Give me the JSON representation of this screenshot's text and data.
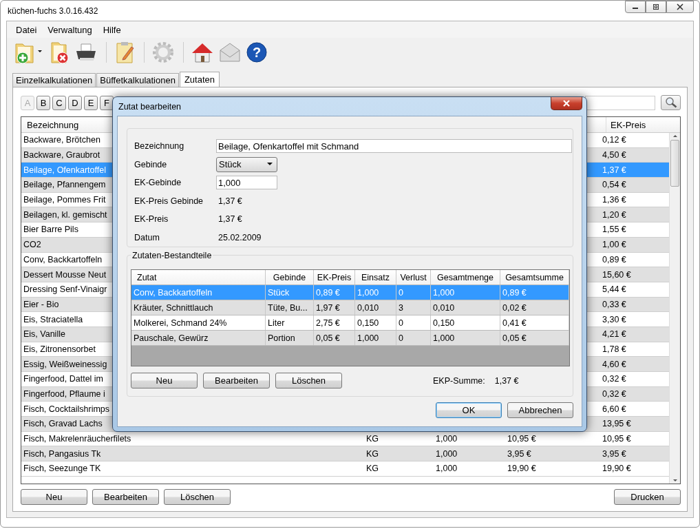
{
  "window": {
    "title": "küchen-fuchs 3.0.16.432"
  },
  "menu": [
    "Datei",
    "Verwaltung",
    "Hilfe"
  ],
  "help_glyph": "?",
  "tabs": [
    {
      "label": "Einzelkalkulationen",
      "selected": false
    },
    {
      "label": "Büffetkalkulationen",
      "selected": false
    },
    {
      "label": "Zutaten",
      "selected": true
    }
  ],
  "letters": [
    {
      "label": "A",
      "disabled": true
    },
    {
      "label": "B",
      "disabled": false
    },
    {
      "label": "C",
      "disabled": false
    },
    {
      "label": "D",
      "disabled": false
    },
    {
      "label": "E",
      "disabled": false
    },
    {
      "label": "F",
      "disabled": false
    }
  ],
  "table": {
    "columns": [
      "Bezeichnung",
      "EK-Preis"
    ],
    "rows": [
      {
        "name": "Backware, Brötchen",
        "ek_preis": "0,12 €",
        "selected": false
      },
      {
        "name": "Backware, Graubrot",
        "ek_preis": "4,50 €",
        "selected": false
      },
      {
        "name": "Beilage, Ofenkartoffel",
        "ek_preis": "1,37 €",
        "selected": true
      },
      {
        "name": "Beilage, Pfannengem",
        "ek_preis": "0,54 €",
        "selected": false
      },
      {
        "name": "Beilage, Pommes Frit",
        "ek_preis": "1,36 €",
        "selected": false
      },
      {
        "name": "Beilagen, kl. gemischt",
        "ek_preis": "1,20 €",
        "selected": false
      },
      {
        "name": "Bier Barre Pils",
        "ek_preis": "1,55 €",
        "selected": false
      },
      {
        "name": "CO2",
        "ek_preis": "1,00 €",
        "selected": false
      },
      {
        "name": "Conv, Backkartoffeln",
        "ek_preis": "0,89 €",
        "selected": false
      },
      {
        "name": "Dessert Mousse Neut",
        "ek_preis": "15,60 €",
        "selected": false
      },
      {
        "name": "Dressing Senf-Vinaigr",
        "ek_preis": "5,44 €",
        "selected": false
      },
      {
        "name": "Eier - Bio",
        "ek_preis": "0,33 €",
        "selected": false
      },
      {
        "name": "Eis, Straciatella",
        "ek_preis": "3,30 €",
        "selected": false
      },
      {
        "name": "Eis, Vanille",
        "ek_preis": "4,21 €",
        "selected": false
      },
      {
        "name": "Eis, Zitronensorbet",
        "ek_preis": "1,78 €",
        "selected": false
      },
      {
        "name": "Essig, Weißweinessig",
        "ek_preis": "4,60 €",
        "selected": false
      },
      {
        "name": "Fingerfood, Dattel im",
        "ek_preis": "0,32 €",
        "selected": false
      },
      {
        "name": "Fingerfood, Pflaume i",
        "ek_preis": "0,32 €",
        "selected": false
      },
      {
        "name": "Fisch, Cocktailshrimps",
        "ek_preis": "6,60 €",
        "selected": false
      },
      {
        "name": "Fisch, Gravad Lachs",
        "ek_preis": "13,95 €",
        "selected": false
      },
      {
        "name": "Fisch, Makrelenräucherfilets",
        "column_2": "KG",
        "column_3": "1,000",
        "column_4": "10,95 €",
        "ek_preis": "10,95 €",
        "selected": false
      },
      {
        "name": "Fisch, Pangasius Tk",
        "column_2": "KG",
        "column_3": "1,000",
        "column_4": "3,95 €",
        "ek_preis": "3,95 €",
        "selected": false
      },
      {
        "name": "Fisch, Seezunge TK",
        "column_2": "KG",
        "column_3": "1,000",
        "column_4": "19,90 €",
        "ek_preis": "19,90 €",
        "selected": false
      }
    ]
  },
  "buttons": [
    "Neu",
    "Bearbeiten",
    "Löschen"
  ],
  "print_button": "Drucken",
  "dialog": {
    "title": "Zutat bearbeiten",
    "fields": [
      {
        "label": "Bezeichnung",
        "kind": "text",
        "value": "Beilage, Ofenkartoffel mit Schmand"
      },
      {
        "label": "Gebinde",
        "kind": "select",
        "value": "Stück"
      },
      {
        "label": "EK-Gebinde",
        "kind": "input",
        "value": "1,000"
      },
      {
        "label": "EK-Preis Gebinde",
        "kind": "readonly",
        "value": "1,37 €"
      },
      {
        "label": "EK-Preis",
        "kind": "readonly",
        "value": "1,37 €"
      },
      {
        "label": "Datum",
        "kind": "readonly",
        "value": "25.02.2009"
      }
    ],
    "group_title": "Zutaten-Bestandteile",
    "components": {
      "columns": [
        "Zutat",
        "Gebinde",
        "EK-Preis",
        "Einsatz",
        "Verlust",
        "Gesamtmenge",
        "Gesamtsumme"
      ],
      "rows": [
        {
          "cells": [
            "Conv, Backkartoffeln",
            "Stück",
            "0,89 €",
            "1,000",
            "0",
            "1,000",
            "0,89 €"
          ],
          "selected": true
        },
        {
          "cells": [
            "Kräuter, Schnittlauch",
            "Tüte, Bu...",
            "1,97 €",
            "0,010",
            "3",
            "0,010",
            "0,02 €"
          ],
          "selected": false
        },
        {
          "cells": [
            "Molkerei, Schmand 24%",
            "Liter",
            "2,75 €",
            "0,150",
            "0",
            "0,150",
            "0,41 €"
          ],
          "selected": false
        },
        {
          "cells": [
            "Pauschale, Gewürz",
            "Portion",
            "0,05 €",
            "1,000",
            "0",
            "1,000",
            "0,05 €"
          ],
          "selected": false
        }
      ]
    },
    "buttons": [
      "Neu",
      "Bearbeiten",
      "Löschen"
    ],
    "sum_label": "EKP-Summe:",
    "sum_value": "1,37 €",
    "actions": [
      {
        "label": "OK",
        "default": true
      },
      {
        "label": "Abbrechen",
        "default": false
      }
    ]
  }
}
